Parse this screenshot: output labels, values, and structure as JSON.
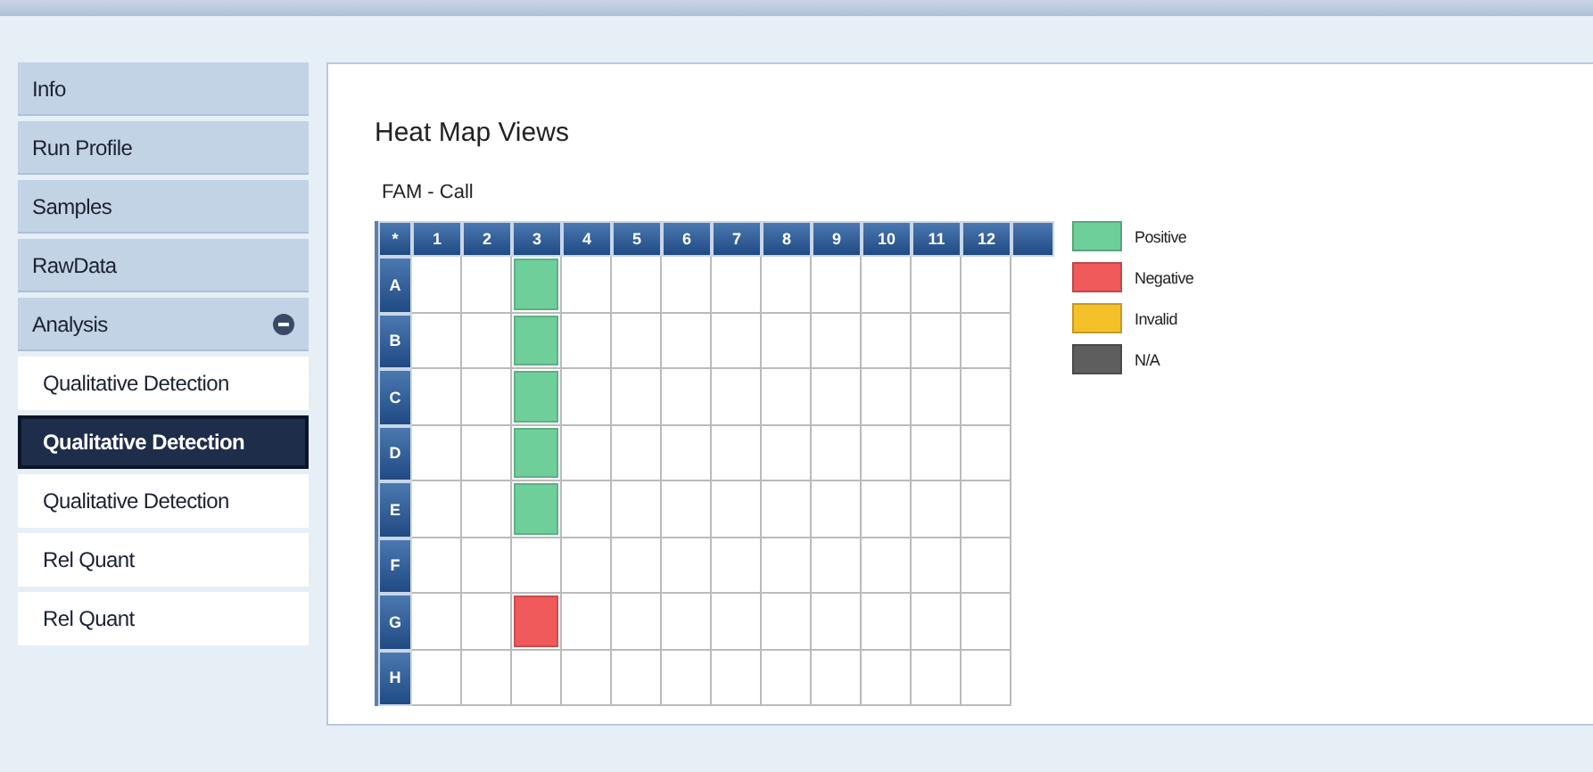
{
  "sidebar": {
    "items": [
      {
        "label": "Info",
        "kind": "section",
        "selected": false
      },
      {
        "label": "Run Profile",
        "kind": "section",
        "selected": false
      },
      {
        "label": "Samples",
        "kind": "section",
        "selected": false
      },
      {
        "label": "RawData",
        "kind": "section",
        "selected": false
      },
      {
        "label": "Analysis",
        "kind": "section",
        "selected": false,
        "expanded": true
      },
      {
        "label": "Qualitative Detection",
        "kind": "sub",
        "selected": false
      },
      {
        "label": "Qualitative Detection",
        "kind": "sub",
        "selected": true
      },
      {
        "label": "Qualitative Detection",
        "kind": "sub",
        "selected": false
      },
      {
        "label": "Rel Quant",
        "kind": "sub",
        "selected": false
      },
      {
        "label": "Rel Quant",
        "kind": "sub",
        "selected": false
      }
    ]
  },
  "main": {
    "title": "Heat Map Views",
    "subtitle": "FAM - Call",
    "heatmap": {
      "corner": "*",
      "columns": [
        "1",
        "2",
        "3",
        "4",
        "5",
        "6",
        "7",
        "8",
        "9",
        "10",
        "11",
        "12"
      ],
      "rows": [
        {
          "label": "A",
          "cells": [
            {
              "kind": "empty"
            },
            {
              "kind": "empty"
            },
            {
              "kind": "positive"
            },
            {
              "kind": "empty"
            },
            {
              "kind": "empty"
            },
            {
              "kind": "empty"
            },
            {
              "kind": "empty"
            },
            {
              "kind": "empty"
            },
            {
              "kind": "empty"
            },
            {
              "kind": "empty"
            },
            {
              "kind": "empty"
            },
            {
              "kind": "empty"
            }
          ]
        },
        {
          "label": "B",
          "cells": [
            {
              "kind": "empty"
            },
            {
              "kind": "empty"
            },
            {
              "kind": "positive"
            },
            {
              "kind": "empty"
            },
            {
              "kind": "empty"
            },
            {
              "kind": "empty"
            },
            {
              "kind": "empty"
            },
            {
              "kind": "empty"
            },
            {
              "kind": "empty"
            },
            {
              "kind": "empty"
            },
            {
              "kind": "empty"
            },
            {
              "kind": "empty"
            }
          ]
        },
        {
          "label": "C",
          "cells": [
            {
              "kind": "empty"
            },
            {
              "kind": "empty"
            },
            {
              "kind": "positive"
            },
            {
              "kind": "empty"
            },
            {
              "kind": "empty"
            },
            {
              "kind": "empty"
            },
            {
              "kind": "empty"
            },
            {
              "kind": "empty"
            },
            {
              "kind": "empty"
            },
            {
              "kind": "empty"
            },
            {
              "kind": "empty"
            },
            {
              "kind": "empty"
            }
          ]
        },
        {
          "label": "D",
          "cells": [
            {
              "kind": "empty"
            },
            {
              "kind": "empty"
            },
            {
              "kind": "positive"
            },
            {
              "kind": "empty"
            },
            {
              "kind": "empty"
            },
            {
              "kind": "empty"
            },
            {
              "kind": "empty"
            },
            {
              "kind": "empty"
            },
            {
              "kind": "empty"
            },
            {
              "kind": "empty"
            },
            {
              "kind": "empty"
            },
            {
              "kind": "empty"
            }
          ]
        },
        {
          "label": "E",
          "cells": [
            {
              "kind": "empty"
            },
            {
              "kind": "empty"
            },
            {
              "kind": "positive"
            },
            {
              "kind": "empty"
            },
            {
              "kind": "empty"
            },
            {
              "kind": "empty"
            },
            {
              "kind": "empty"
            },
            {
              "kind": "empty"
            },
            {
              "kind": "empty"
            },
            {
              "kind": "empty"
            },
            {
              "kind": "empty"
            },
            {
              "kind": "empty"
            }
          ]
        },
        {
          "label": "F",
          "cells": [
            {
              "kind": "empty"
            },
            {
              "kind": "empty"
            },
            {
              "kind": "empty"
            },
            {
              "kind": "empty"
            },
            {
              "kind": "empty"
            },
            {
              "kind": "empty"
            },
            {
              "kind": "empty"
            },
            {
              "kind": "empty"
            },
            {
              "kind": "empty"
            },
            {
              "kind": "empty"
            },
            {
              "kind": "empty"
            },
            {
              "kind": "empty"
            }
          ]
        },
        {
          "label": "G",
          "cells": [
            {
              "kind": "empty"
            },
            {
              "kind": "empty"
            },
            {
              "kind": "negative"
            },
            {
              "kind": "empty"
            },
            {
              "kind": "empty"
            },
            {
              "kind": "empty"
            },
            {
              "kind": "empty"
            },
            {
              "kind": "empty"
            },
            {
              "kind": "empty"
            },
            {
              "kind": "empty"
            },
            {
              "kind": "empty"
            },
            {
              "kind": "empty"
            }
          ]
        },
        {
          "label": "H",
          "cells": [
            {
              "kind": "empty"
            },
            {
              "kind": "empty"
            },
            {
              "kind": "empty"
            },
            {
              "kind": "empty"
            },
            {
              "kind": "empty"
            },
            {
              "kind": "empty"
            },
            {
              "kind": "empty"
            },
            {
              "kind": "empty"
            },
            {
              "kind": "empty"
            },
            {
              "kind": "empty"
            },
            {
              "kind": "empty"
            },
            {
              "kind": "empty"
            }
          ]
        }
      ]
    },
    "legend": [
      {
        "kind": "positive",
        "label": "Positive",
        "color": "#6fcf9a"
      },
      {
        "kind": "negative",
        "label": "Negative",
        "color": "#f05a5a"
      },
      {
        "kind": "invalid",
        "label": "Invalid",
        "color": "#f5c12a"
      },
      {
        "kind": "na",
        "label": "N/A",
        "color": "#5e5e5e"
      }
    ]
  }
}
